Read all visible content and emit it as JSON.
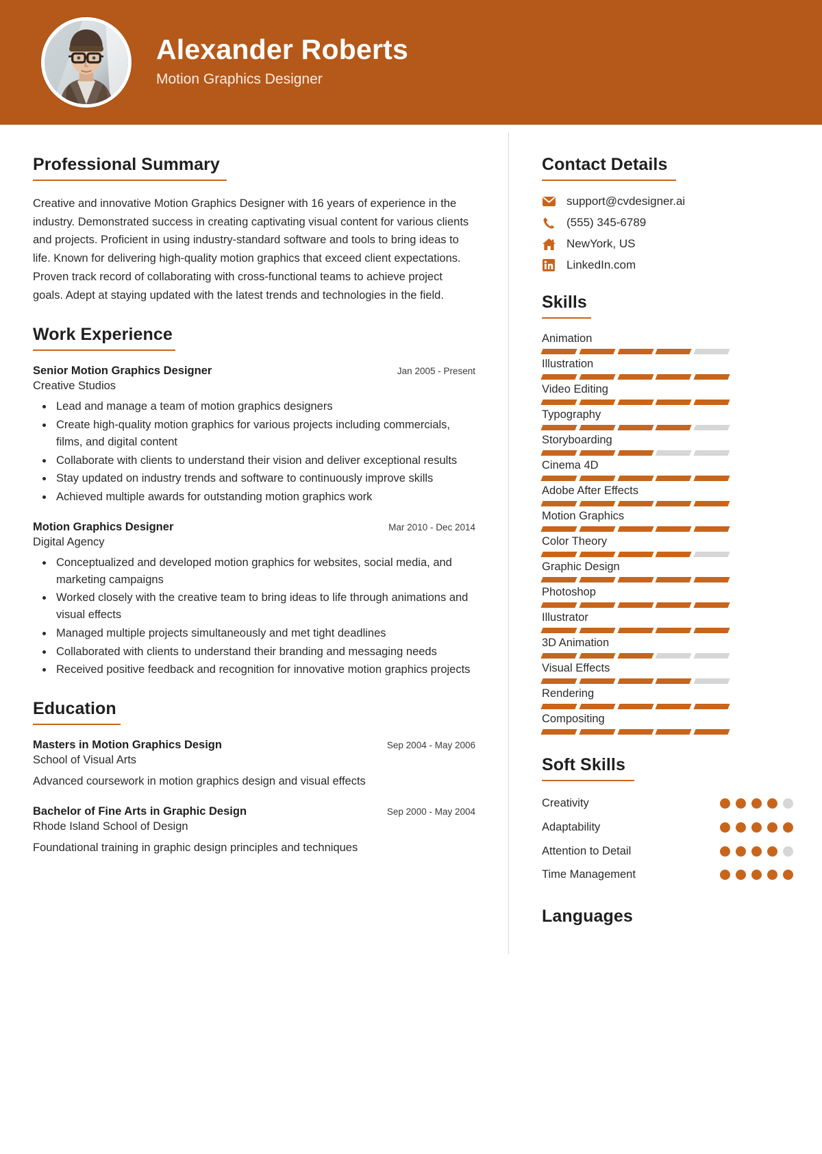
{
  "theme": {
    "accent": "#c8651c",
    "header_bg": "#b4591a",
    "muted": "#d6d6d6"
  },
  "header": {
    "name": "Alexander Roberts",
    "job_title": "Motion Graphics Designer",
    "avatar_icon": "profile-photo"
  },
  "main": {
    "summary": {
      "heading": "Professional Summary",
      "text": "Creative and innovative Motion Graphics Designer with 16 years of experience in the industry. Demonstrated success in creating captivating visual content for various clients and projects. Proficient in using industry-standard software and tools to bring ideas to life. Known for delivering high-quality motion graphics that exceed client expectations. Proven track record of collaborating with cross-functional teams to achieve project goals. Adept at staying updated with the latest trends and technologies in the field."
    },
    "work": {
      "heading": "Work Experience",
      "jobs": [
        {
          "role": "Senior Motion Graphics Designer",
          "date": "Jan 2005 - Present",
          "org": "Creative Studios",
          "bullets": [
            "Lead and manage a team of motion graphics designers",
            "Create high-quality motion graphics for various projects including commercials, films, and digital content",
            "Collaborate with clients to understand their vision and deliver exceptional results",
            "Stay updated on industry trends and software to continuously improve skills",
            "Achieved multiple awards for outstanding motion graphics work"
          ]
        },
        {
          "role": "Motion Graphics Designer",
          "date": "Mar 2010 - Dec 2014",
          "org": "Digital Agency",
          "bullets": [
            "Conceptualized and developed motion graphics for websites, social media, and marketing campaigns",
            "Worked closely with the creative team to bring ideas to life through animations and visual effects",
            "Managed multiple projects simultaneously and met tight deadlines",
            "Collaborated with clients to understand their branding and messaging needs",
            "Received positive feedback and recognition for innovative motion graphics projects"
          ]
        }
      ]
    },
    "education": {
      "heading": "Education",
      "entries": [
        {
          "degree": "Masters in Motion Graphics Design",
          "date": "Sep 2004 - May 2006",
          "school": "School of Visual Arts",
          "desc": "Advanced coursework in motion graphics design and visual effects"
        },
        {
          "degree": "Bachelor of Fine Arts in Graphic Design",
          "date": "Sep 2000 - May 2004",
          "school": "Rhode Island School of Design",
          "desc": "Foundational training in graphic design principles and techniques"
        }
      ]
    }
  },
  "sidebar": {
    "contact": {
      "heading": "Contact Details",
      "items": [
        {
          "icon": "envelope-icon",
          "value": "support@cvdesigner.ai"
        },
        {
          "icon": "phone-icon",
          "value": "(555) 345-6789"
        },
        {
          "icon": "home-icon",
          "value": "NewYork, US"
        },
        {
          "icon": "linkedin-icon",
          "value": "LinkedIn.com"
        }
      ]
    },
    "skills": {
      "heading": "Skills",
      "max": 5,
      "items": [
        {
          "name": "Animation",
          "level": 4
        },
        {
          "name": "Illustration",
          "level": 5
        },
        {
          "name": "Video Editing",
          "level": 5
        },
        {
          "name": "Typography",
          "level": 4
        },
        {
          "name": "Storyboarding",
          "level": 3
        },
        {
          "name": "Cinema 4D",
          "level": 5
        },
        {
          "name": "Adobe After Effects",
          "level": 5
        },
        {
          "name": "Motion Graphics",
          "level": 5
        },
        {
          "name": "Color Theory",
          "level": 4
        },
        {
          "name": "Graphic Design",
          "level": 5
        },
        {
          "name": "Photoshop",
          "level": 5
        },
        {
          "name": "Illustrator",
          "level": 5
        },
        {
          "name": "3D Animation",
          "level": 3
        },
        {
          "name": "Visual Effects",
          "level": 4
        },
        {
          "name": "Rendering",
          "level": 5
        },
        {
          "name": "Compositing",
          "level": 5
        }
      ]
    },
    "soft_skills": {
      "heading": "Soft Skills",
      "max": 5,
      "items": [
        {
          "name": "Creativity",
          "level": 4
        },
        {
          "name": "Adaptability",
          "level": 5
        },
        {
          "name": "Attention to Detail",
          "level": 4
        },
        {
          "name": "Time Management",
          "level": 5
        }
      ]
    },
    "languages": {
      "heading": "Languages"
    }
  }
}
